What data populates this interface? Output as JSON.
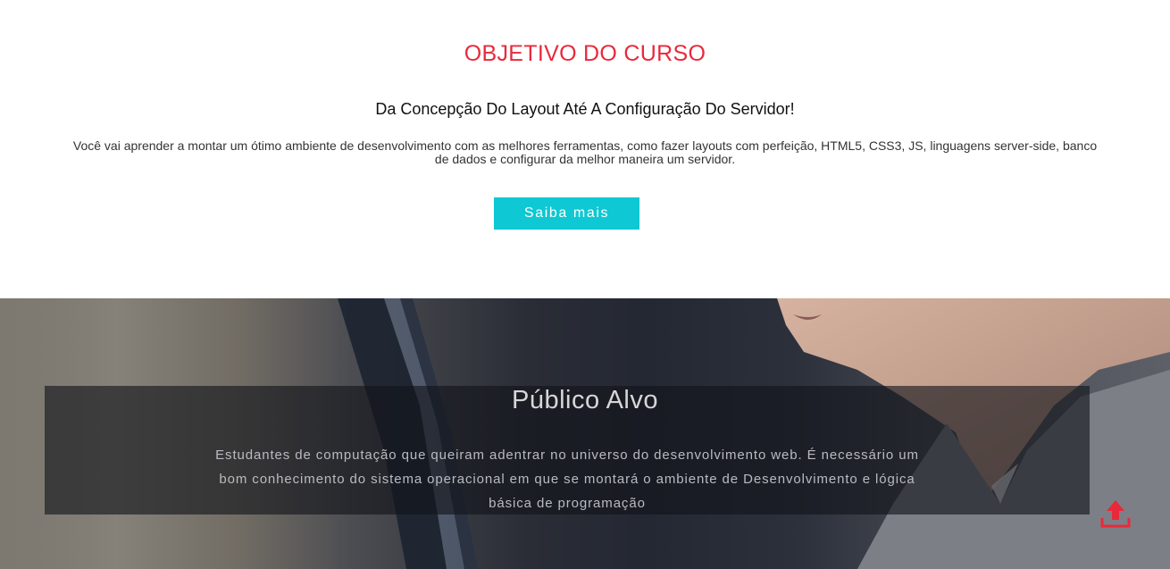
{
  "objetivo": {
    "title": "OBJETIVO DO CURSO",
    "subtitle": "Da Concepção Do Layout Até A Configuração Do Servidor!",
    "description": "Você vai aprender a montar um ótimo ambiente de desenvolvimento com as melhores ferramentas, como fazer layouts com perfeição, HTML5, CSS3, JS, linguagens server-side, banco de dados e configurar da melhor maneira um servidor.",
    "button_label": "Saiba mais"
  },
  "publico": {
    "title": "Público Alvo",
    "description": "Estudantes de computação que queiram adentrar no universo do desenvolvimento web. É necessário um bom conhecimento do sistema operacional em que se montará o ambiente de Desenvolvimento e lógica básica de programação"
  },
  "icons": {
    "scroll_top": "upload-arrow-icon"
  },
  "colors": {
    "accent_red": "#e8293b",
    "button_cyan": "#0ec8d3",
    "overlay": "rgba(18,20,26,0.62)"
  }
}
